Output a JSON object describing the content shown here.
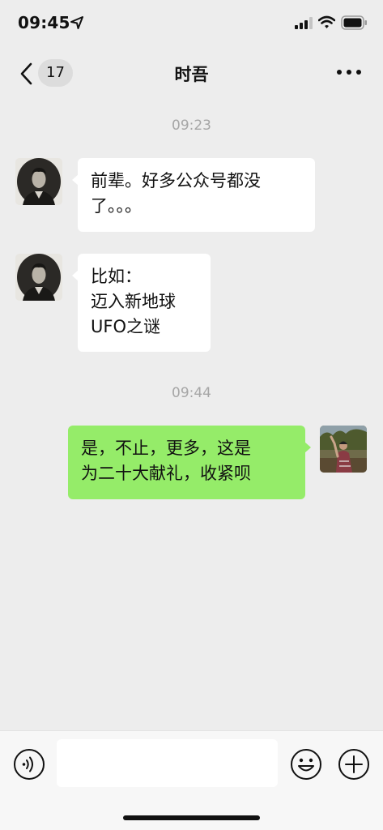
{
  "status_bar": {
    "time": "09:45",
    "icons": [
      "location-arrow-icon",
      "cellular-signal-icon",
      "wifi-icon",
      "battery-icon"
    ]
  },
  "nav": {
    "back_icon": "chevron-left-icon",
    "unread_count": "17",
    "title": "时吾",
    "more_icon": "more-dots-icon"
  },
  "messages": [
    {
      "type": "timestamp",
      "text": "09:23"
    },
    {
      "type": "message",
      "side": "left",
      "lines": [
        "前辈。好多公众号都没",
        "了。。。"
      ]
    },
    {
      "type": "message",
      "side": "left",
      "lines": [
        "比如：",
        "迈入新地球",
        "UFO之谜"
      ]
    },
    {
      "type": "timestamp",
      "text": "09:44"
    },
    {
      "type": "message",
      "side": "right",
      "lines": [
        "是，不止，更多，这是",
        "为二十大献礼，收紧呗"
      ]
    }
  ],
  "input_bar": {
    "voice_icon": "voice-icon",
    "input_value": "",
    "emoji_icon": "emoji-icon",
    "plus_icon": "plus-icon"
  },
  "colors": {
    "background": "#ededed",
    "incoming_bubble": "#ffffff",
    "outgoing_bubble": "#95ec69",
    "timestamp_text": "#a6a6a6"
  }
}
